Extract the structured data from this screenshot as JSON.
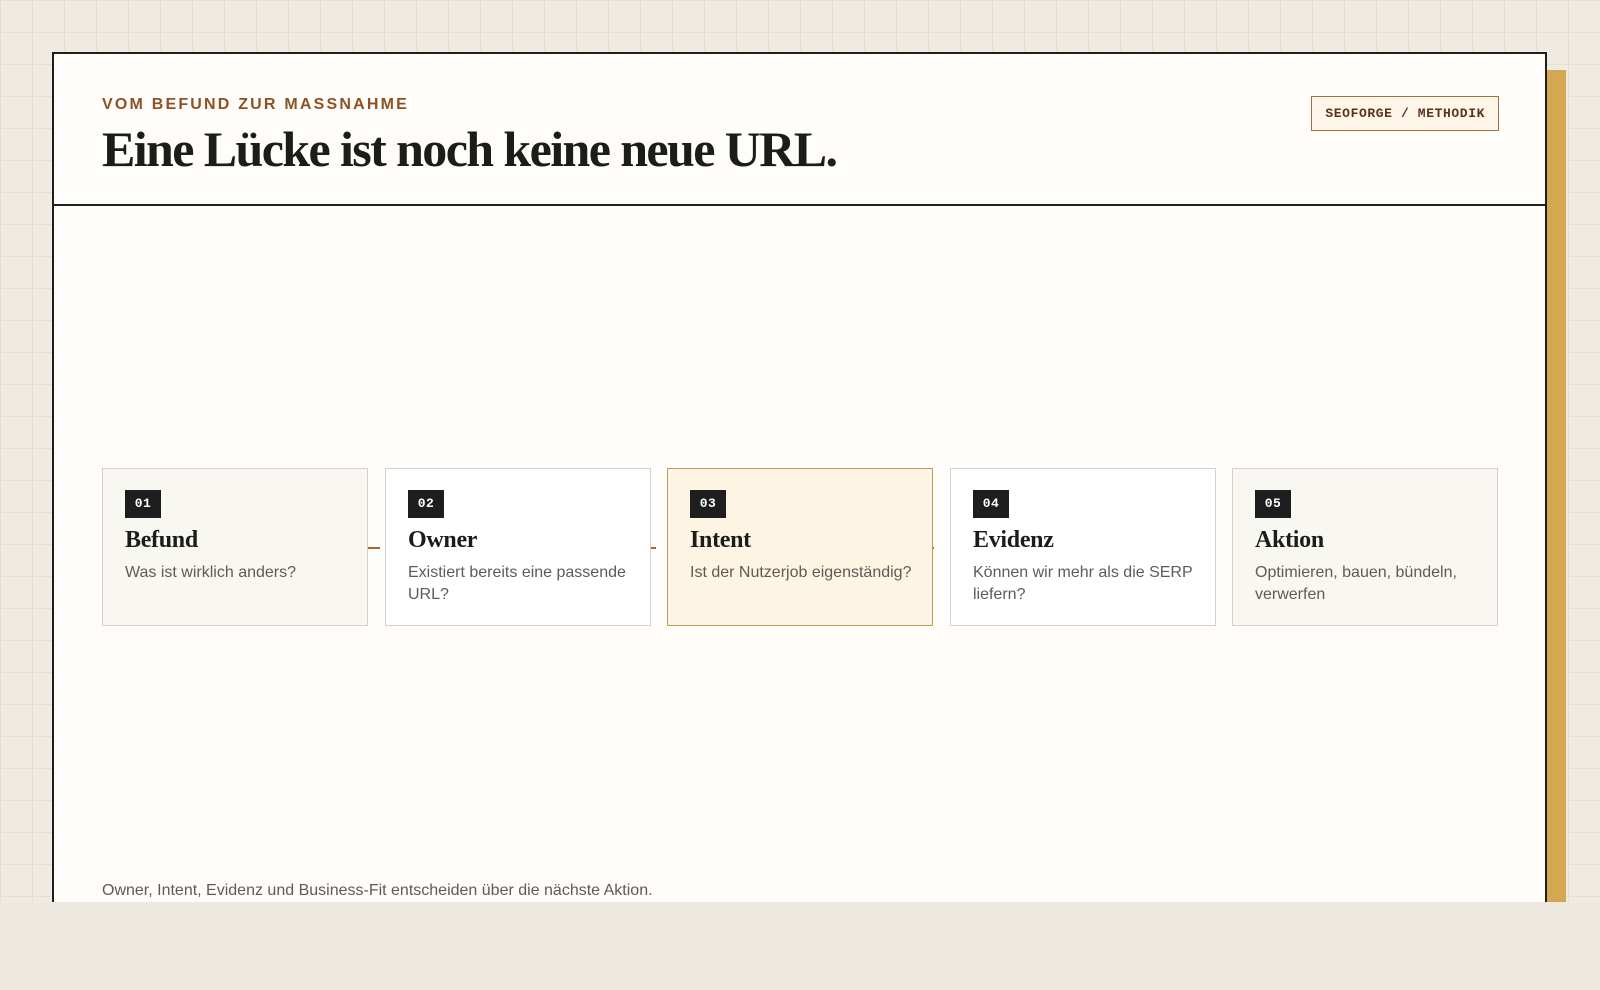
{
  "header": {
    "eyebrow": "VOM BEFUND ZUR MASSNAHME",
    "title": "Eine Lücke ist noch keine neue URL.",
    "badge": "SEOFORGE / METHODIK"
  },
  "steps": [
    {
      "number": "01",
      "title": "Befund",
      "description": "Was ist wirklich anders?",
      "state": "muted"
    },
    {
      "number": "02",
      "title": "Owner",
      "description": "Existiert bereits eine passende URL?",
      "state": "default"
    },
    {
      "number": "03",
      "title": "Intent",
      "description": "Ist der Nutzerjob eigenständig?",
      "state": "active"
    },
    {
      "number": "04",
      "title": "Evidenz",
      "description": "Können wir mehr als die SERP liefern?",
      "state": "default"
    },
    {
      "number": "05",
      "title": "Aktion",
      "description": "Optimieren, bauen, bündeln, verwerfen",
      "state": "muted"
    }
  ],
  "footer": {
    "note": "Owner, Intent, Evidenz und Business-Fit entscheiden über die nächste Aktion."
  },
  "colors": {
    "accent": "#8e5124",
    "shadow": "#d4a853",
    "active_step_bg": "#fef4e4",
    "ink": "#1c1c19"
  }
}
